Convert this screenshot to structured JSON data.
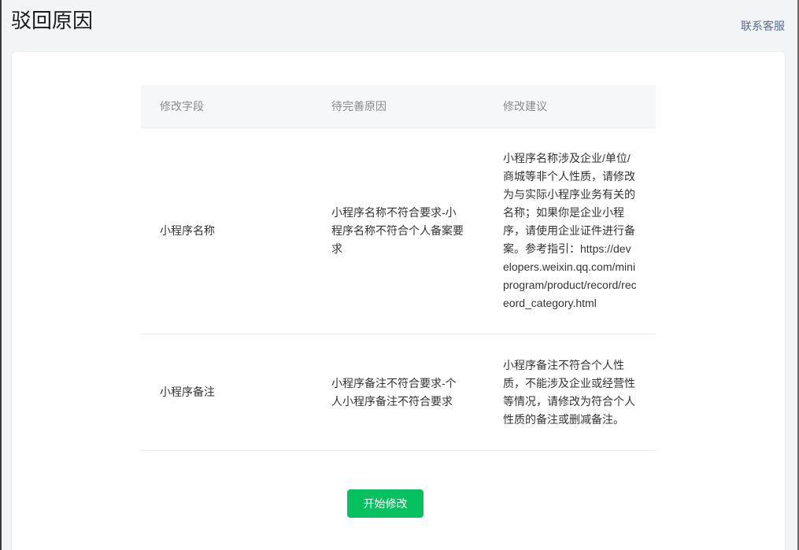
{
  "header": {
    "title": "驳回原因",
    "contact_link": "联系客服"
  },
  "table": {
    "headers": [
      "修改字段",
      "待完善原因",
      "修改建议"
    ],
    "rows": [
      {
        "field": "小程序名称",
        "reason": "小程序名称不符合要求-小程序名称不符合个人备案要求",
        "suggestion": "小程序名称涉及企业/单位/商城等非个人性质，请修改为与实际小程序业务有关的名称；如果你是企业小程序，请使用企业证件进行备案。参考指引：https://developers.weixin.qq.com/miniprogram/product/record/receord_category.html"
      },
      {
        "field": "小程序备注",
        "reason": "小程序备注不符合要求-个人小程序备注不符合要求",
        "suggestion": "小程序备注不符合个人性质，不能涉及企业或经营性等情况，请修改为符合个人性质的备注或删减备注。"
      }
    ]
  },
  "actions": {
    "start_edit_label": "开始修改"
  },
  "colors": {
    "accent": "#07c160",
    "link": "#576b95",
    "background": "#f3f4f6"
  }
}
